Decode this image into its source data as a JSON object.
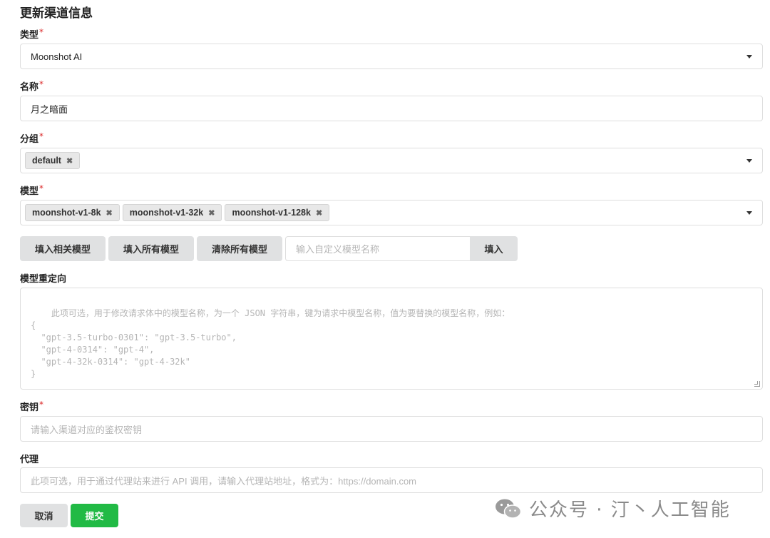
{
  "title": "更新渠道信息",
  "required_mark": "*",
  "type": {
    "label": "类型",
    "value": "Moonshot AI"
  },
  "name": {
    "label": "名称",
    "value": "月之暗面"
  },
  "group": {
    "label": "分组",
    "chips": [
      "default"
    ]
  },
  "models": {
    "label": "模型",
    "chips": [
      "moonshot-v1-8k",
      "moonshot-v1-32k",
      "moonshot-v1-128k"
    ]
  },
  "model_actions": {
    "fill_related": "填入相关模型",
    "fill_all": "填入所有模型",
    "clear_all": "清除所有模型",
    "custom_placeholder": "输入自定义模型名称",
    "fill": "填入"
  },
  "model_mapping": {
    "label": "模型重定向",
    "placeholder": "此项可选，用于修改请求体中的模型名称，为一个 JSON 字符串，键为请求中模型名称，值为要替换的模型名称，例如：\n{\n  \"gpt-3.5-turbo-0301\": \"gpt-3.5-turbo\",\n  \"gpt-4-0314\": \"gpt-4\",\n  \"gpt-4-32k-0314\": \"gpt-4-32k\"\n}"
  },
  "key": {
    "label": "密钥",
    "placeholder": "请输入渠道对应的鉴权密钥"
  },
  "proxy": {
    "label": "代理",
    "placeholder": "此项可选，用于通过代理站来进行 API 调用，请输入代理站地址，格式为：https://domain.com"
  },
  "buttons": {
    "cancel": "取消",
    "submit": "提交"
  },
  "watermark": "公众号 · 汀丶人工智能",
  "colors": {
    "submit": "#21ba45",
    "required": "#db2828"
  }
}
